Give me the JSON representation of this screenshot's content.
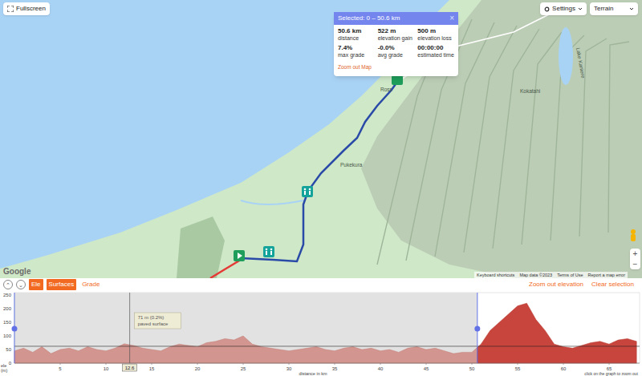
{
  "map": {
    "fullscreen": "Fullscreen",
    "settings": "Settings",
    "map_type": "Terrain",
    "labels": [
      "Pukekura",
      "Kokatahi",
      "Lake Kaniere",
      "Ross"
    ],
    "logo": "Google",
    "footer": [
      "Keyboard shortcuts",
      "Map data ©2023",
      "Terms of Use",
      "Report a map error"
    ],
    "zoom": [
      "+",
      "−"
    ]
  },
  "popup": {
    "title": "Selected: 0 – 50.6 km",
    "close": "×",
    "stats": [
      {
        "value": "50.6 km",
        "label": "distance"
      },
      {
        "value": "522 m",
        "label": "elevation gain"
      },
      {
        "value": "500 m",
        "label": "elevation loss"
      },
      {
        "value": "7.4%",
        "label": "max grade"
      },
      {
        "value": "-0.0%",
        "label": "avg grade"
      },
      {
        "value": "00:00:00",
        "label": "estimated time"
      }
    ],
    "link": "Zoom out Map"
  },
  "toolbar": {
    "arrows": [
      "⌃",
      "⌄"
    ],
    "tabs": [
      {
        "label": "Ele",
        "selected": true
      },
      {
        "label": "Surfaces",
        "selected": true
      },
      {
        "label": "Grade",
        "selected": false
      }
    ],
    "actions": [
      "Zoom out elevation",
      "Clear selection"
    ]
  },
  "chart": {
    "y_label": [
      "ele",
      "(m)"
    ],
    "y_ticks": [
      "250",
      "200",
      "150",
      "100",
      "50",
      "0"
    ],
    "x_ticks": [
      "5",
      "10",
      "15",
      "20",
      "25",
      "30",
      "35",
      "40",
      "45",
      "50",
      "55",
      "60",
      "65"
    ],
    "x_label": "distance in km",
    "hint": "click on the graph to zoom out",
    "selection": {
      "start": 0,
      "end": 50.6
    },
    "cursor": {
      "km": 12.6,
      "label": "12.6",
      "tooltip": [
        "71 m (0.2%)",
        "paved surface"
      ]
    },
    "reference_line": 62,
    "series": [
      {
        "name": "elevation",
        "step_km": 1,
        "values": [
          45,
          55,
          40,
          60,
          35,
          50,
          55,
          45,
          60,
          50,
          45,
          55,
          71,
          65,
          55,
          50,
          45,
          60,
          70,
          65,
          60,
          75,
          80,
          90,
          85,
          100,
          70,
          60,
          55,
          50,
          45,
          50,
          55,
          60,
          50,
          45,
          55,
          60,
          50,
          55,
          45,
          50,
          40,
          55,
          60,
          50,
          55,
          45,
          35,
          40,
          40,
          70,
          120,
          150,
          180,
          210,
          220,
          160,
          120,
          70,
          60,
          55,
          65,
          75,
          80,
          70,
          85,
          90,
          80
        ]
      }
    ]
  }
}
